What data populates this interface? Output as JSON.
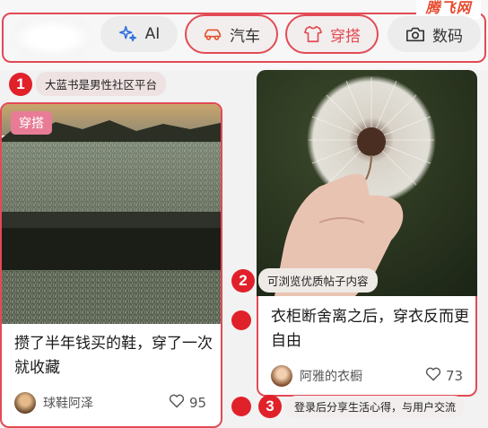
{
  "brand": {
    "logo_text": "腾飞网"
  },
  "categories": {
    "blurred_chip": "",
    "items": [
      {
        "label": "AI",
        "icon": "sparkle-icon"
      },
      {
        "label": "汽车",
        "icon": "car-icon"
      },
      {
        "label": "穿搭",
        "icon": "shirt-icon"
      },
      {
        "label": "数码",
        "icon": "camera-icon"
      }
    ]
  },
  "callouts": [
    {
      "number": "1",
      "text": "大蓝书是男性社区平台"
    },
    {
      "number": "2",
      "text": "可浏览优质帖子内容"
    },
    {
      "number": "3",
      "text": "登录后分享生活心得，与用户交流"
    }
  ],
  "feed": {
    "left_card": {
      "tag": "穿搭",
      "title": "攒了半年钱买的鞋，穿了一次就收藏",
      "author": "球鞋阿泽",
      "likes": "95"
    },
    "right_card": {
      "title": "衣柜断舍离之后，穿衣反而更自由",
      "author": "阿雅的衣橱",
      "likes": "73"
    }
  },
  "colors": {
    "accent_red": "#e0212a",
    "outline_red": "#e24a55",
    "tag_pink": "#e87c97",
    "brand_orange": "#e64a2e"
  }
}
